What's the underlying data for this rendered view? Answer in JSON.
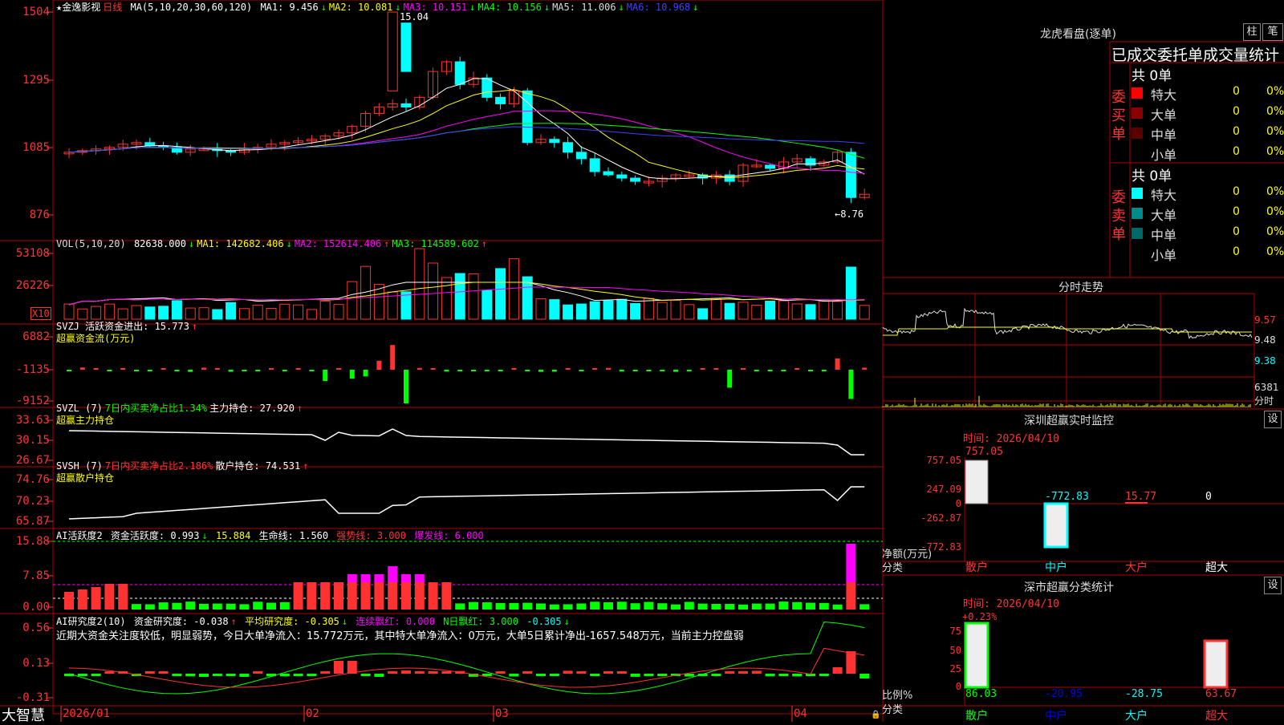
{
  "stock": {
    "name": "★金逸影视",
    "period": "日线"
  },
  "price_header": {
    "ma_label": "MA(5,10,20,30,60,120)",
    "items": [
      {
        "label": "MA1: ",
        "value": "9.456",
        "arrow": "↓",
        "color": "#ffffff"
      },
      {
        "label": "MA2: ",
        "value": "10.081",
        "arrow": "↓",
        "color": "#ffff00"
      },
      {
        "label": "MA3: ",
        "value": "10.151",
        "arrow": "↓",
        "color": "#ff00ff"
      },
      {
        "label": "MA4: ",
        "value": "10.156",
        "arrow": "↓",
        "color": "#00ff00"
      },
      {
        "label": "MA5: ",
        "value": "11.006",
        "arrow": "↓",
        "color": "#dddddd"
      },
      {
        "label": "MA6: ",
        "value": "10.968",
        "arrow": "↓",
        "color": "#4040ff"
      }
    ],
    "high_marker": "15.04",
    "low_marker": "←8.76"
  },
  "price_axis": [
    "1504",
    "1295",
    "1085",
    "876"
  ],
  "vol_header": {
    "label": "VOL(5,10,20)",
    "items": [
      {
        "label": " ",
        "value": "82638.000",
        "arrow": "↓",
        "color": "#ffffff"
      },
      {
        "label": "MA1: ",
        "value": "142682.406",
        "arrow": "↓",
        "color": "#ffff00"
      },
      {
        "label": "MA2: ",
        "value": "152614.406",
        "arrow": "↑",
        "color": "#ff00ff"
      },
      {
        "label": "MA3: ",
        "value": "114589.602",
        "arrow": "↑",
        "color": "#00ff00"
      }
    ]
  },
  "vol_axis": [
    "53108",
    "26226"
  ],
  "vol_unit": "X10",
  "svzj": {
    "title": "SVZJ  活跃资金进出: 15.773",
    "arrow": "↑",
    "subtitle": "超赢资金流(万元)",
    "axis": [
      "6882",
      "-1135",
      "-9152"
    ]
  },
  "svzl": {
    "title": "SVZL (7)",
    "t2": "7日内买卖净占比1.34%",
    "t3": "主力持仓: 27.920",
    "arrow": "↑",
    "subtitle": "超赢主力持仓",
    "axis": [
      "33.63",
      "30.15",
      "26.67"
    ]
  },
  "svsh": {
    "title": "SVSH (7)",
    "t2": "7日内买卖净占比2.186%",
    "t3": "散户持仓: 74.531",
    "arrow": "↑",
    "subtitle": "超赢散户持仓",
    "axis": [
      "74.76",
      "70.23",
      "65.87"
    ]
  },
  "ai_active": {
    "title": "AI活跃度2",
    "t1": "资金活跃度: 0.993",
    "t2": "15.884",
    "t3": "生命线: 1.560",
    "t4": "强势线: 3.000",
    "t5": "爆发线: 6.000",
    "axis": [
      "15.88",
      "7.85",
      "0.00"
    ]
  },
  "ai_research": {
    "title": "AI研究度2(10)",
    "t1": "资金研究度: -0.038",
    "t2": "平均研究度: -0.305",
    "t3": "连续飘红: 0.000",
    "t4": "N日飘红: 3.000",
    "t5": "-0.305",
    "summary": "近期大资金关注度较低，明显弱势，今日大单净流入：15.772万元，其中特大单净流入：0万元，大单5日累计净出-1657.548万元，当前主力控盘弱",
    "axis": [
      "0.56",
      "0.13",
      "-0.31"
    ]
  },
  "x_axis": {
    "brand": "大智慧",
    "labels": [
      "2026/01",
      "02",
      "03",
      "04"
    ]
  },
  "right": {
    "dragon_title": "龙虎看盘(逐单)",
    "tab_zhu": "柱",
    "tab_bi": "笔",
    "stats_title": "已成交委托单成交量统计",
    "buy_label": "委买单",
    "sell_label": "委卖单",
    "buy_total": "共 0单",
    "sell_total": "共 0单",
    "buy_rows": [
      {
        "label": "特大",
        "count": "0",
        "pct": "0%",
        "color": "#ff0000"
      },
      {
        "label": "大单",
        "count": "0",
        "pct": "0%",
        "color": "#8b0000"
      },
      {
        "label": "中单",
        "count": "0",
        "pct": "0%",
        "color": "#5a0000"
      },
      {
        "label": "小单",
        "count": "0",
        "pct": "0%",
        "color": "#000000"
      }
    ],
    "sell_rows": [
      {
        "label": "特大",
        "count": "0",
        "pct": "0%",
        "color": "#00ffff"
      },
      {
        "label": "大单",
        "count": "0",
        "pct": "0%",
        "color": "#008b8b"
      },
      {
        "label": "中单",
        "count": "0",
        "pct": "0%",
        "color": "#006868"
      },
      {
        "label": "小单",
        "count": "0",
        "pct": "0%",
        "color": "#000000"
      }
    ],
    "intraday_title": "分时走势",
    "intraday_axis": [
      "9.57",
      "9.48",
      "9.38"
    ],
    "intraday_vol": "6381",
    "intraday_unit": "分时",
    "monitor_title": "深圳超赢实时监控",
    "monitor_time": "时间: 2026/04/10",
    "monitor_axis": [
      "757.05",
      "247.09",
      "0",
      "-262.87",
      "-772.83"
    ],
    "monitor_ylabel": "净额(万元)",
    "monitor_xlabel": "分类",
    "monitor_cats": [
      "散户",
      "中户",
      "大户",
      "超大"
    ],
    "monitor_values": [
      "757.05",
      "-772.83",
      "15.77",
      "0"
    ],
    "setting": "设",
    "class_title": "深市超赢分类统计",
    "class_time": "时间: 2026/04/10",
    "class_pct_top": "+0.23%",
    "class_axis": [
      "75",
      "50",
      "25",
      "0"
    ],
    "class_ylabel": "比例%",
    "class_xlabel": "分类",
    "class_cats": [
      "散户",
      "中户",
      "大户",
      "超大"
    ],
    "class_values": [
      "86.03",
      "-20.95",
      "-28.75",
      "63.67"
    ]
  },
  "colors": {
    "up": "#ff3232",
    "down": "#00ffff",
    "grid": "#b00000",
    "active": "#ff00ff",
    "inflow": "#00ff00"
  }
}
